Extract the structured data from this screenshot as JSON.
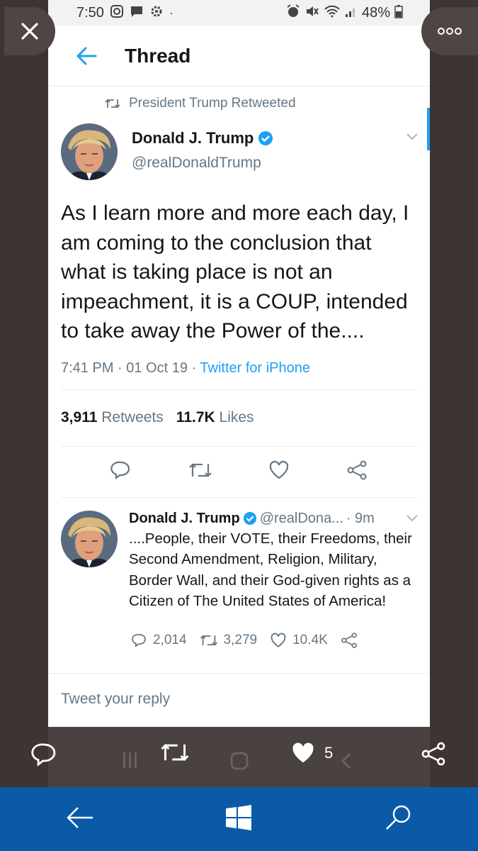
{
  "status_bar": {
    "time": "7:50",
    "battery": "48%"
  },
  "header": {
    "title": "Thread"
  },
  "retweet_context": {
    "label": "President Trump Retweeted"
  },
  "main_tweet": {
    "author_name": "Donald J. Trump",
    "author_handle": "@realDonaldTrump",
    "text": "As I learn more and more each day, I am coming to the conclusion that what is taking place is not an impeachment, it is a COUP, intended to take away the Power of the....",
    "timestamp": "7:41 PM · 01 Oct 19 · ",
    "source": "Twitter for iPhone",
    "retweets_count": "3,911",
    "retweets_label": "Retweets",
    "likes_count": "11.7K",
    "likes_label": "Likes"
  },
  "reply_tweet": {
    "author_name": "Donald J. Trump",
    "author_handle": "@realDona...",
    "time": "· 9m",
    "text": "....People, their VOTE, their Freedoms, their Second Amendment, Religion, Military, Border Wall, and their God-given rights as a Citizen of The United States of America!",
    "replies": "2,014",
    "retweets": "3,279",
    "likes": "10.4K"
  },
  "reply_box": {
    "placeholder": "Tweet your reply"
  },
  "overlay_toolbar": {
    "likes_count": "5"
  },
  "colors": {
    "twitter_blue": "#1da1f2",
    "frame": "#3e3532",
    "taskbar": "#0b5aa8"
  }
}
